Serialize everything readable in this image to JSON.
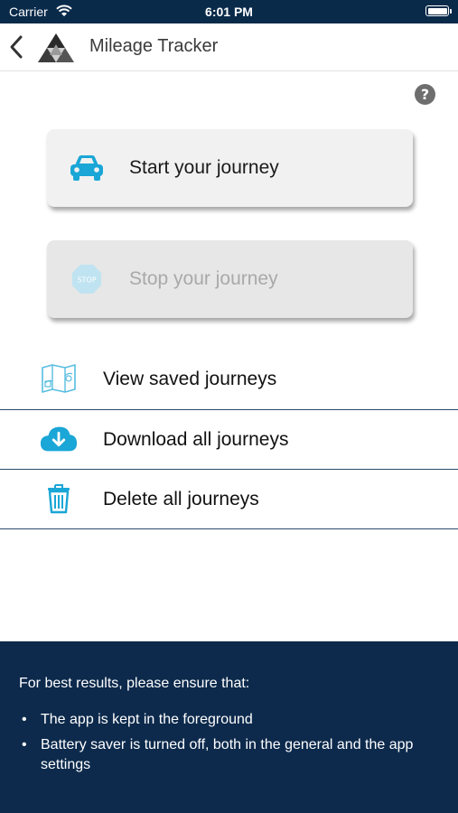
{
  "status_bar": {
    "carrier": "Carrier",
    "time": "6:01 PM"
  },
  "header": {
    "title": "Mileage Tracker"
  },
  "help": {
    "label": "?"
  },
  "actions": {
    "start": {
      "label": "Start your journey",
      "icon": "car-icon",
      "enabled": true
    },
    "stop": {
      "label": "Stop your journey",
      "icon": "stop-sign-icon",
      "enabled": false,
      "icon_text": "STOP"
    }
  },
  "menu": [
    {
      "label": "View saved journeys",
      "icon": "map-icon"
    },
    {
      "label": "Download all journeys",
      "icon": "cloud-download-icon"
    },
    {
      "label": "Delete all journeys",
      "icon": "trash-icon"
    }
  ],
  "footer": {
    "intro": "For best results, please ensure that:",
    "bullets": [
      "The app is kept in the foreground",
      "Battery saver is turned off, both in the general and the app settings"
    ]
  },
  "colors": {
    "accent": "#1aa6d6",
    "navy": "#0d2a4c",
    "disabled_text": "#a9a9a9"
  }
}
